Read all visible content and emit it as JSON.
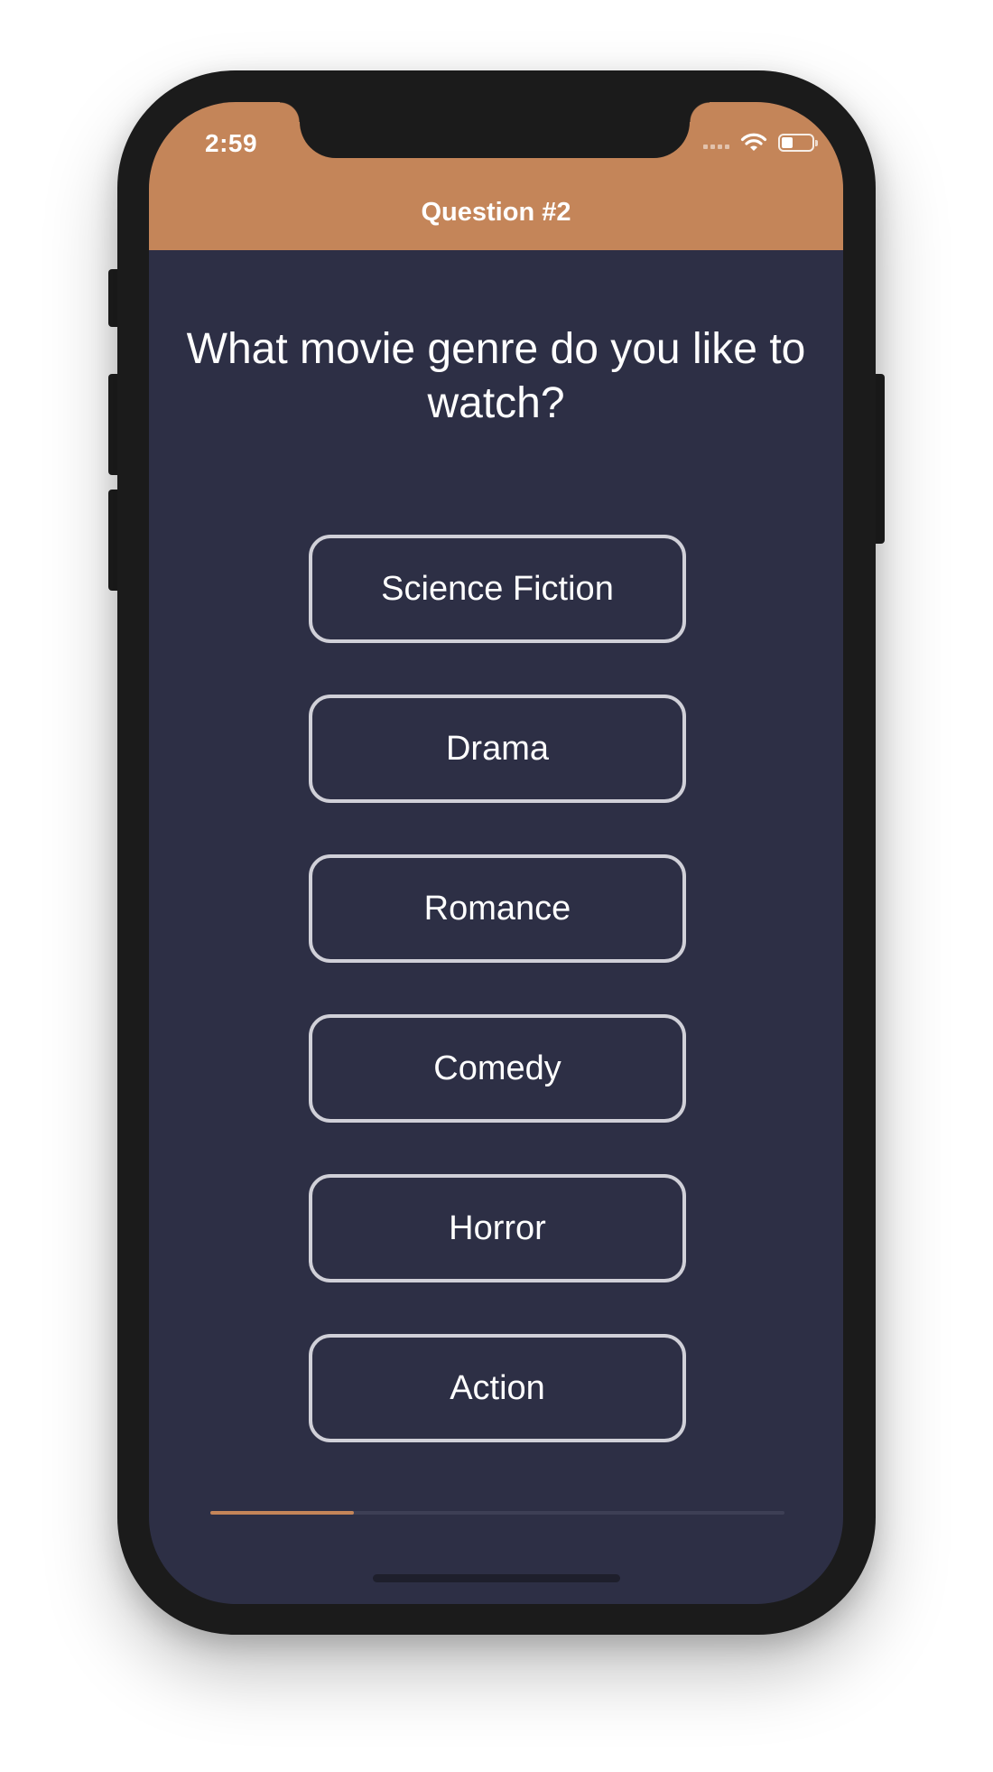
{
  "status_bar": {
    "time": "2:59",
    "icons": [
      "signal-icon",
      "wifi-icon",
      "battery-icon"
    ]
  },
  "nav": {
    "title": "Question #2"
  },
  "question": {
    "text": "What movie genre do you like to watch?"
  },
  "answers": [
    {
      "label": "Science Fiction"
    },
    {
      "label": "Drama"
    },
    {
      "label": "Romance"
    },
    {
      "label": "Comedy"
    },
    {
      "label": "Horror"
    },
    {
      "label": "Action"
    }
  ],
  "progress": {
    "fraction": 0.25
  },
  "colors": {
    "accent": "#c48559",
    "background": "#2d2f45",
    "button_border": "#d0d0d8",
    "text": "#ffffff",
    "device_frame": "#1b1b1b"
  }
}
